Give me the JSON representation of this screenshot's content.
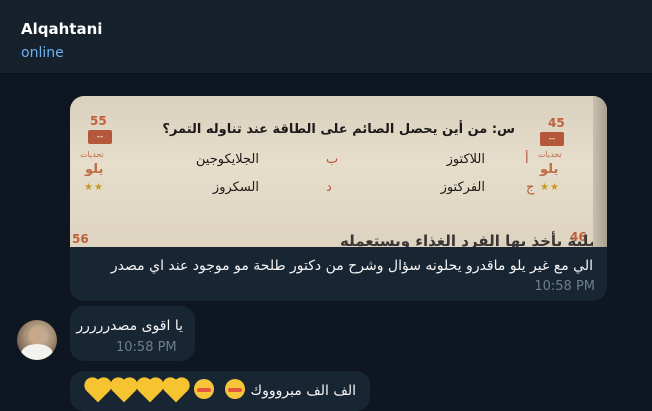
{
  "header": {
    "contact_name": "Alqahtani",
    "status": "online"
  },
  "messages": [
    {
      "photo": {
        "question": "س: من أين يحصل الصائم على الطاقة عند تناوله التمر؟",
        "options": [
          {
            "letter": "أ",
            "text": "اللاكتوز"
          },
          {
            "letter": "ب",
            "text": "الجلايكوجين"
          },
          {
            "letter": "ج",
            "text": "الفركتوز"
          },
          {
            "letter": "د",
            "text": "السكروز"
          }
        ],
        "page_numbers": [
          "55",
          "45",
          "56",
          "46"
        ],
        "side_label": "تحديات",
        "side_logo": "يلو",
        "side_boxes": [
          "--",
          "--"
        ],
        "stars": "★★",
        "bottom_text": "عملية يأخذ بها الفرد الغذاء ويستعمله"
      },
      "caption": "الي مع غير يلو ماقدرو يحلونه سؤال وشرح من دكتور طلحة مو موجود عند اي مصدر",
      "time": "10:58 PM"
    },
    {
      "text": "يا اقوى مصدررررر",
      "time": "10:58 PM",
      "avatar": "sender-avatar"
    },
    {
      "text": "الف الف مبروووك",
      "emojis": [
        "yellow-heart-icon",
        "yellow-heart-icon",
        "yellow-heart-icon",
        "yellow-heart-icon",
        "blushing-face-icon",
        "blushing-face-icon"
      ]
    }
  ]
}
